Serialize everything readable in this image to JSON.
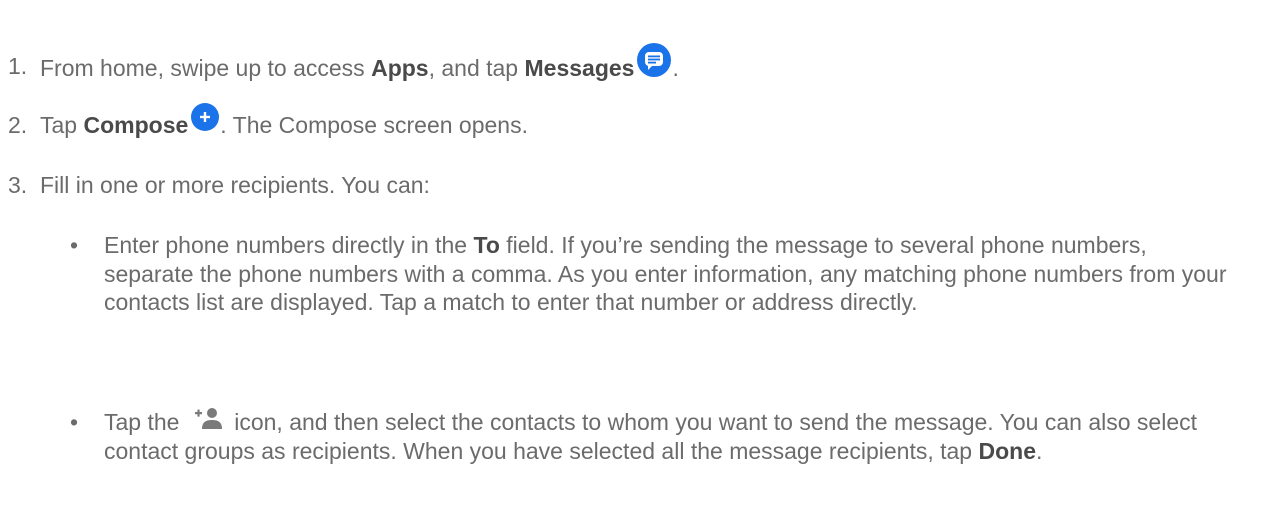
{
  "steps": [
    {
      "num": "1.",
      "t1": "From home, swipe up to access ",
      "b1": "Apps",
      "t2": ", and tap ",
      "b2": "Messages",
      "icon": "messages-app-icon",
      "t3": "."
    },
    {
      "num": "2.",
      "t1": "Tap ",
      "b1": "Compose",
      "icon": "compose-plus-icon",
      "t2": ". The Compose screen opens."
    },
    {
      "num": "3.",
      "t1": "Fill in one or more recipients. You can:"
    }
  ],
  "bullets": [
    {
      "dot": "•",
      "t1": "Enter phone numbers directly in the ",
      "b1": "To",
      "t2": " field. If you’re sending the message to several phone numbers, separate the phone numbers with a comma. As you enter information, any matching phone numbers from your contacts list are displayed. Tap a match to enter that number or address directly."
    },
    {
      "dot": "•",
      "t1": "Tap the ",
      "icon": "add-person-icon",
      "t2": " icon, and then select the contacts to whom you want to send the message. You can also select contact groups as recipients. When you have selected all the message recipients, tap ",
      "b1": "Done",
      "t3": "."
    }
  ],
  "colors": {
    "text": "#6b6b6b",
    "bold": "#4a4a4a",
    "icon_blue": "#1a73e8",
    "icon_gray": "#7a7a7a"
  }
}
